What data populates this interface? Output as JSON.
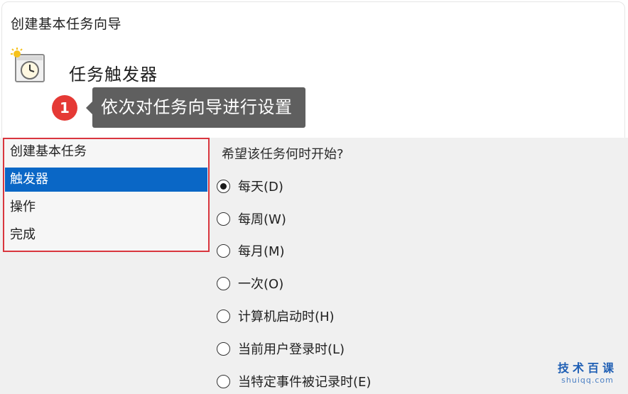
{
  "window": {
    "title": "创建基本任务向导"
  },
  "header": {
    "icon": "scheduled-task-clock-icon",
    "title": "任务触发器"
  },
  "annotation": {
    "badge_number": "1",
    "tooltip_text": "依次对任务向导进行设置",
    "badge_color": "#e53935",
    "tooltip_color": "#5f5f5f"
  },
  "nav": {
    "border_color": "#d9363e",
    "selected_color": "#0a67c6",
    "items": [
      {
        "label": "创建基本任务",
        "selected": false
      },
      {
        "label": "触发器",
        "selected": true
      },
      {
        "label": "操作",
        "selected": false
      },
      {
        "label": "完成",
        "selected": false
      }
    ]
  },
  "trigger": {
    "question": "希望该任务何时开始?",
    "options": [
      {
        "label": "每天(D)",
        "checked": true
      },
      {
        "label": "每周(W)",
        "checked": false
      },
      {
        "label": "每月(M)",
        "checked": false
      },
      {
        "label": "一次(O)",
        "checked": false
      },
      {
        "label": "计算机启动时(H)",
        "checked": false
      },
      {
        "label": "当前用户登录时(L)",
        "checked": false
      },
      {
        "label": "当特定事件被记录时(E)",
        "checked": false
      }
    ]
  },
  "watermark": {
    "cn": "技术百课",
    "en": "shuiqq.com"
  }
}
